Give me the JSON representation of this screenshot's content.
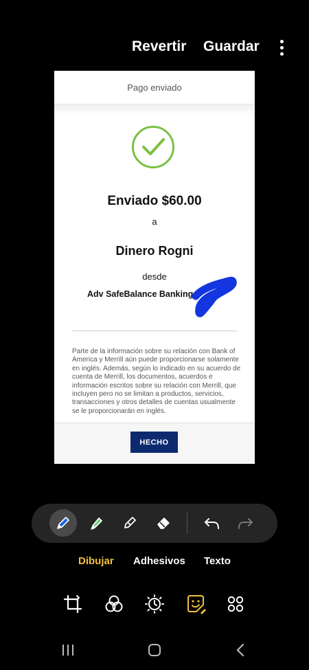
{
  "top_bar": {
    "revert_label": "Revertir",
    "save_label": "Guardar",
    "more_icon": "more-vert-icon"
  },
  "screenshot": {
    "header_title": "Pago enviado",
    "sent_amount": "Enviado $60.00",
    "to_word": "a",
    "recipient": "Dinero Rogni",
    "from_word": "desde",
    "account": "Adv SafeBalance Banking",
    "disclaimer": "Parte de la información sobre su relación con Bank of America y Merrill aún puede proporcionarse solamente en inglés. Además, según lo indicado en su acuerdo de cuenta de Merrill, los documentos, acuerdos e información escritos sobre su relación con Merrill, que incluyen pero no se limitan a productos, servicios, transacciones y otros detalles de cuentas usualmente se le proporcionarán en inglés.",
    "done_label": "HECHO",
    "check_color": "#7ac142",
    "button_color": "#0d2a6e",
    "scribble_color": "#1436e0"
  },
  "draw_toolbar": {
    "tools": [
      "pen-icon",
      "highlighter-icon",
      "pencil-icon",
      "eraser-icon"
    ],
    "actions": [
      "undo-icon",
      "redo-icon"
    ],
    "selected_tool": "pen-icon",
    "pen_color": "#1a5fe8",
    "highlighter_color": "#6fd07a"
  },
  "mode_tabs": {
    "draw": "Dibujar",
    "stickers": "Adhesivos",
    "text": "Texto",
    "active": "Dibujar",
    "active_color": "#f2c03a"
  },
  "bottom_tools": [
    "crop-icon",
    "filter-icon",
    "brightness-icon",
    "sticker-edit-icon",
    "more-tools-icon"
  ],
  "nav_bar": [
    "recents-icon",
    "home-icon",
    "back-icon"
  ]
}
